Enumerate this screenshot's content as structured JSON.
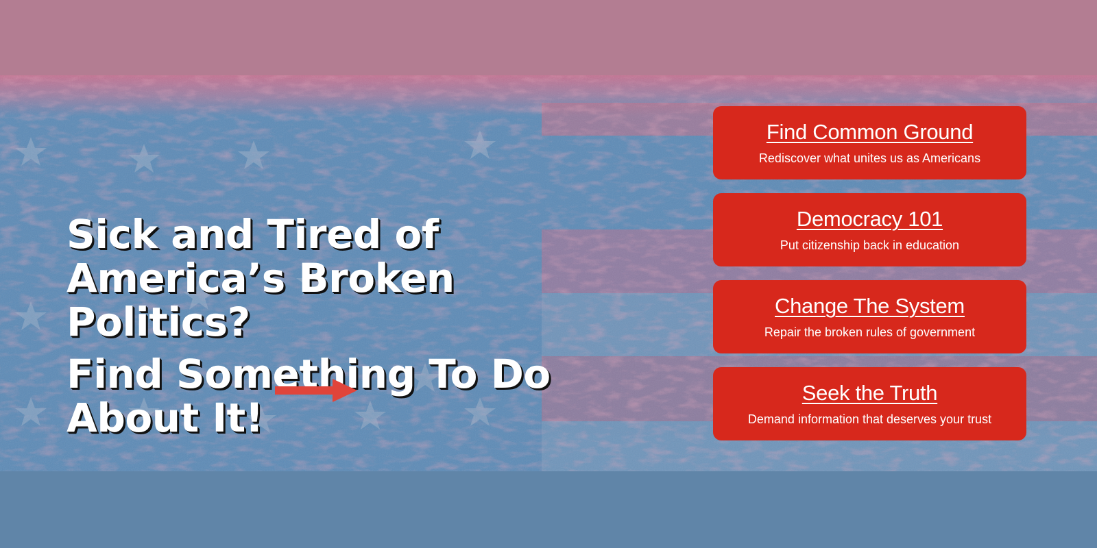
{
  "hero": {
    "headline_lines": [
      "Sick and Tired of",
      "America’s Broken",
      "Politics?"
    ],
    "cta_lines": [
      "Find Something To Do",
      "About It!"
    ],
    "arrow_icon": "arrow-right-icon",
    "arrow_color": "#e0443a"
  },
  "cards": [
    {
      "title": "Find Common Ground",
      "subtitle": "Rediscover what unites us as Americans"
    },
    {
      "title": "Democracy 101",
      "subtitle": "Put citizenship back in education"
    },
    {
      "title": "Change The System",
      "subtitle": "Repair the broken rules of government"
    },
    {
      "title": "Seek the Truth",
      "subtitle": "Demand information that deserves your trust"
    }
  ],
  "colors": {
    "card_bg": "#d7281c",
    "top_band": "#b37d92",
    "bottom_band": "#6085a8"
  }
}
